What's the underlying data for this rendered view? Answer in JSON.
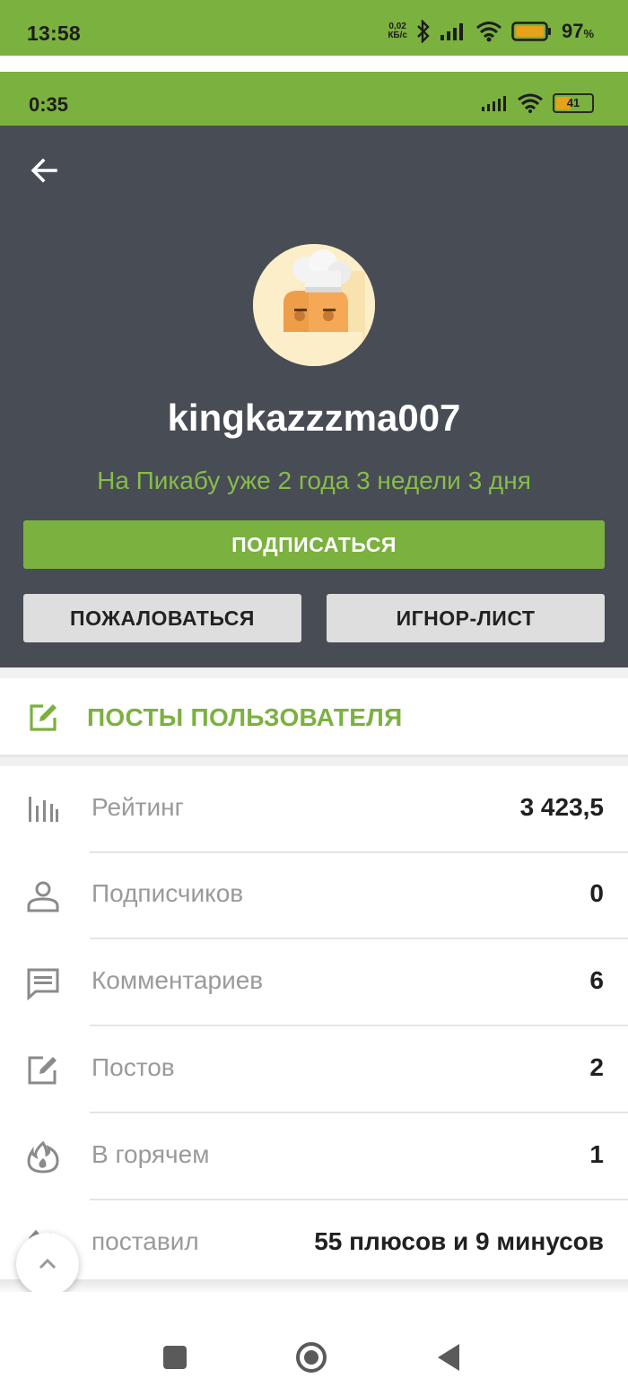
{
  "outer_status": {
    "time": "13:58",
    "speed_top": "0,02",
    "speed_bottom": "КБ/с",
    "battery_pct": "97",
    "battery_unit": "%"
  },
  "inner_status": {
    "time": "0:35",
    "battery": "41"
  },
  "profile": {
    "username": "kingkazzzma007",
    "since": "На Пикабу уже 2 года 3 недели 3 дня",
    "subscribe_label": "ПОДПИСАТЬСЯ",
    "report_label": "ПОЖАЛОВАТЬСЯ",
    "ignore_label": "ИГНОР-ЛИСТ"
  },
  "posts_section": {
    "label": "ПОСТЫ ПОЛЬЗОВАТЕЛЯ"
  },
  "stats": [
    {
      "icon": "rating-icon",
      "label": "Рейтинг",
      "value": "3 423,5"
    },
    {
      "icon": "person-icon",
      "label": "Подписчиков",
      "value": "0"
    },
    {
      "icon": "comment-icon",
      "label": "Комментариев",
      "value": "6"
    },
    {
      "icon": "edit-icon",
      "label": "Постов",
      "value": "2"
    },
    {
      "icon": "fire-icon",
      "label": "В горячем",
      "value": "1"
    },
    {
      "icon": "votes-icon",
      "label": "поставил",
      "value": "55 плюсов и 9 минусов"
    }
  ],
  "colors": {
    "accent_green": "#7bb13f",
    "header_bg": "#484c54",
    "since_green": "#86bd4a"
  }
}
